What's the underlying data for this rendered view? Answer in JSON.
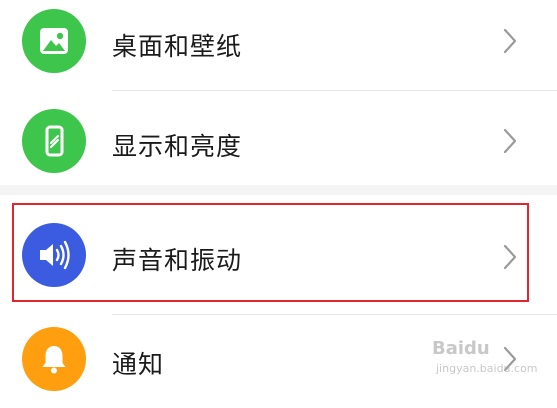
{
  "settings": {
    "items": [
      {
        "label": "桌面和壁纸",
        "icon": "wallpaper-image-icon",
        "icon_color": "#3dc64b"
      },
      {
        "label": "显示和亮度",
        "icon": "phone-display-icon",
        "icon_color": "#3dc64b"
      },
      {
        "label": "声音和振动",
        "icon": "speaker-sound-icon",
        "icon_color": "#3b5ce0"
      },
      {
        "label": "通知",
        "icon": "bell-icon",
        "icon_color": "#ff9f0f"
      }
    ]
  },
  "highlight": {
    "color": "#e0262e",
    "target": "声音和振动"
  },
  "watermark": {
    "main": "Baidu",
    "sub": "jingyan.baidu.com"
  }
}
